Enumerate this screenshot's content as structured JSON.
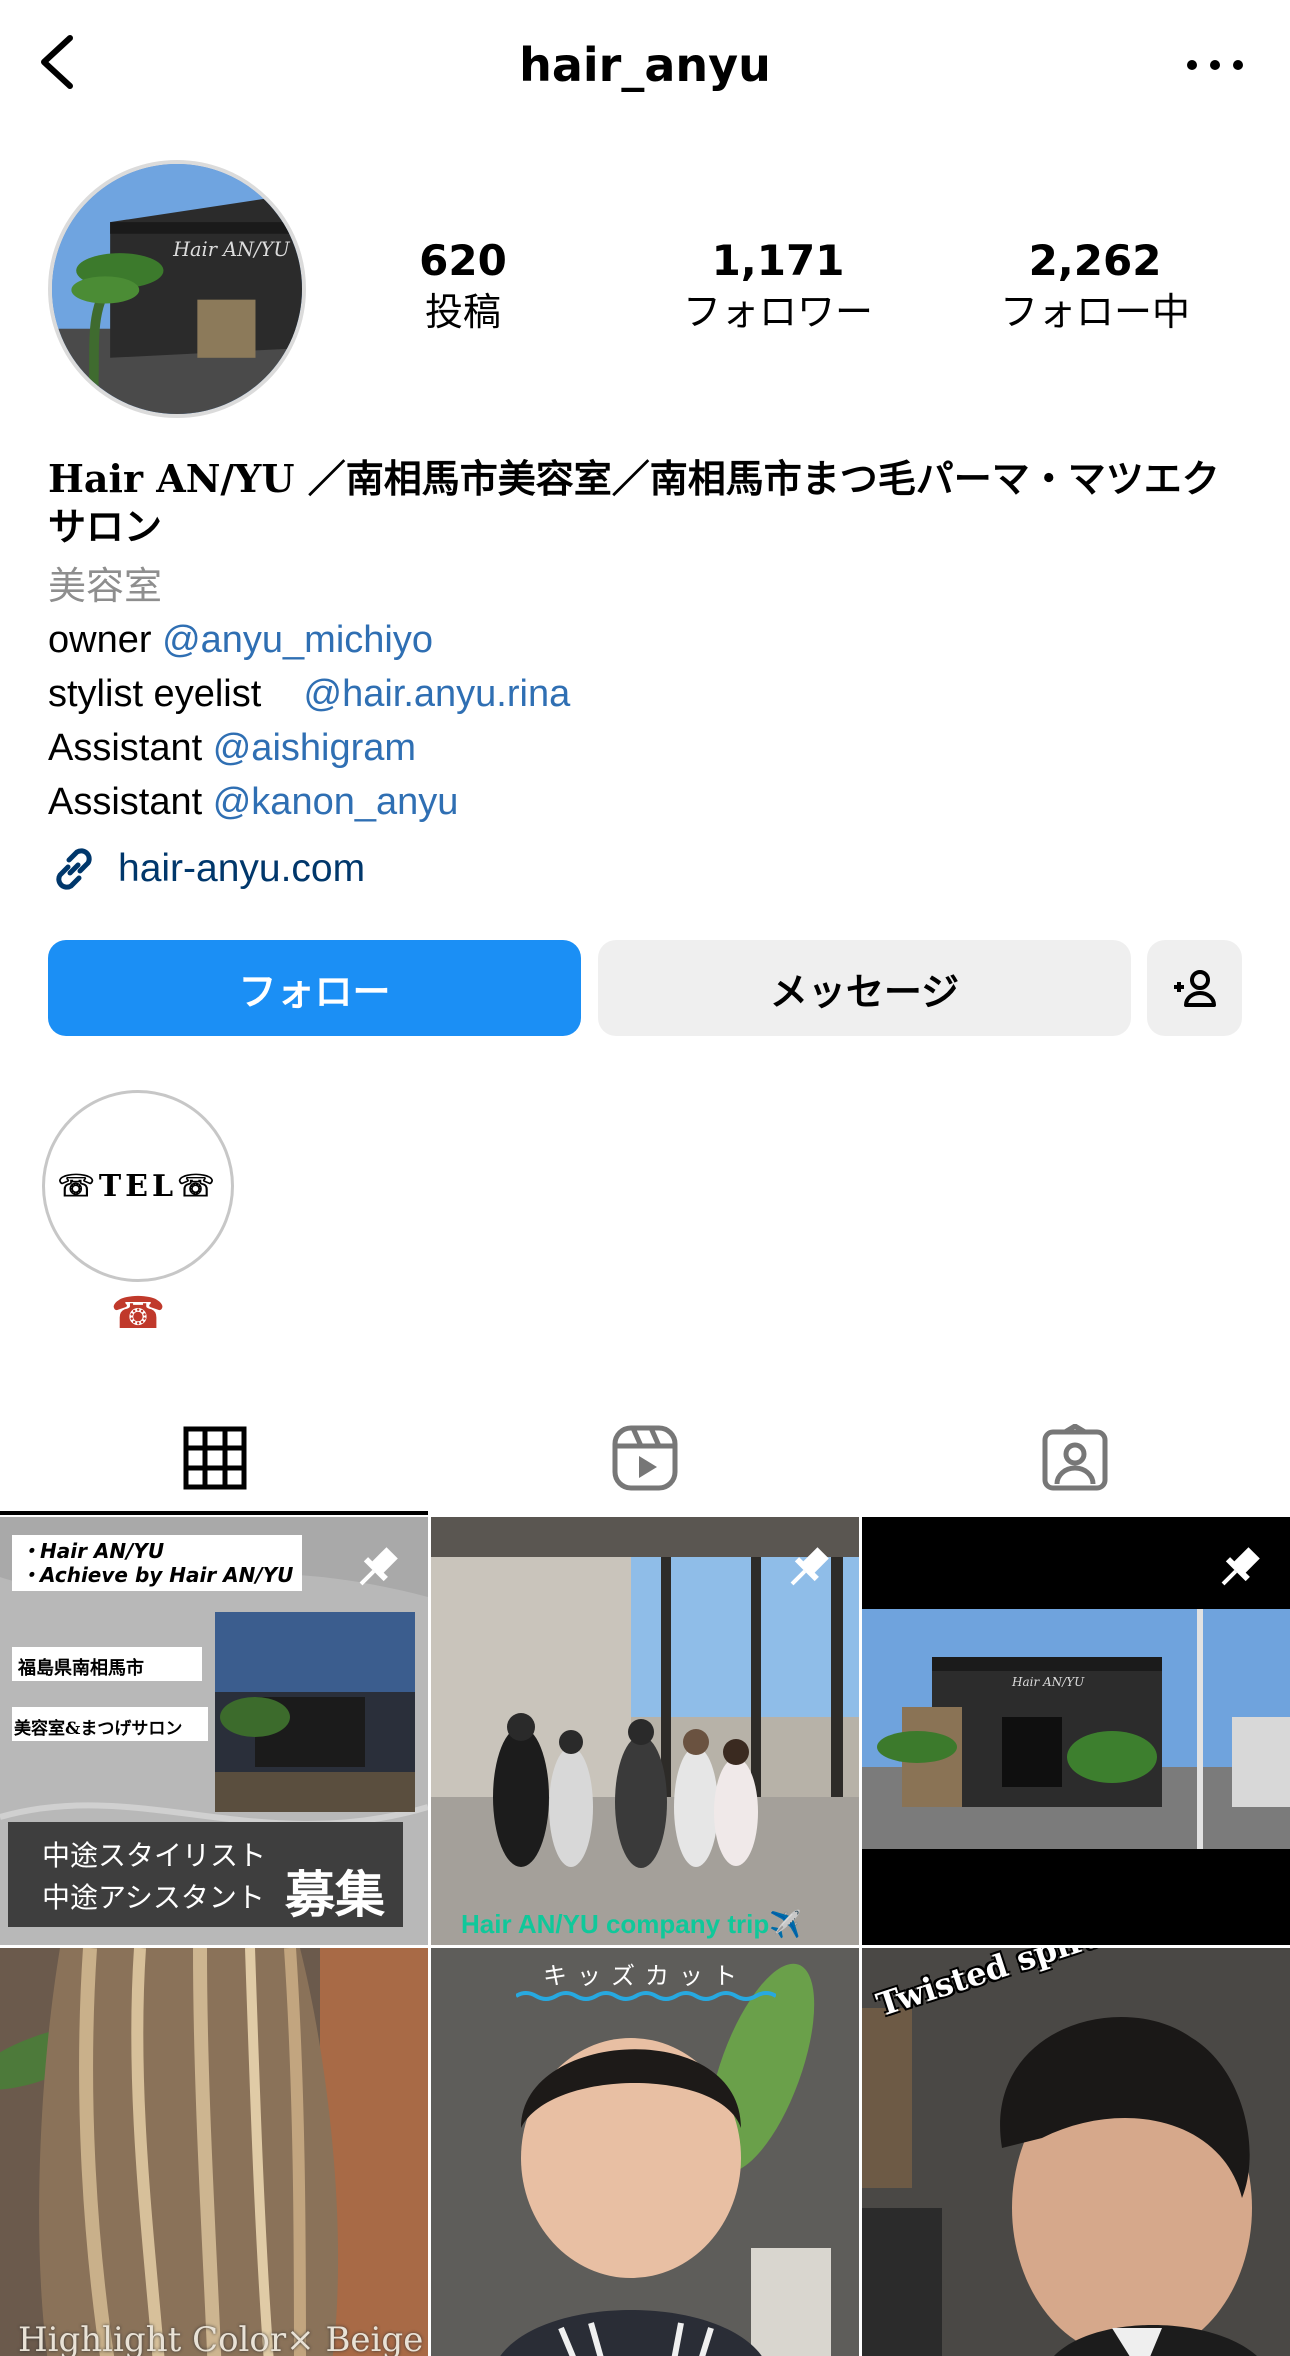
{
  "header": {
    "username": "hair_anyu"
  },
  "stats": [
    {
      "value": "620",
      "label": "投稿"
    },
    {
      "value": "1,171",
      "label": "フォロワー"
    },
    {
      "value": "2,262",
      "label": "フォロー中"
    }
  ],
  "bio": {
    "name_line1": "Hair AN/YU ／南相馬市美容室／南相馬市まつ毛パーマ・マツエク",
    "name_line2": "サロン",
    "category": "美容室",
    "lines": [
      {
        "prefix": "owner ",
        "mention": "@anyu_michiyo"
      },
      {
        "prefix": "stylist eyelist    ",
        "mention": "@hair.anyu.rina"
      },
      {
        "prefix": "Assistant ",
        "mention": "@aishigram"
      },
      {
        "prefix": "Assistant ",
        "mention": "@kanon_anyu"
      }
    ],
    "link": "hair-anyu.com"
  },
  "buttons": {
    "follow": "フォロー",
    "message": "メッセージ"
  },
  "highlight": {
    "cover_text": "☏TEL☏",
    "label": "☎"
  },
  "posts": [
    {
      "lines_top": [
        "・Hair AN/YU",
        "・Achieve by Hair AN/YU"
      ],
      "tag1": "福島県南相馬市",
      "tag2": "美容室&まつげサロン",
      "banner1": "中途スタイリスト",
      "banner2": "中途アシスタント",
      "banner_big": "募集"
    },
    {
      "caption": "Hair AN/YU company trip✈️"
    },
    {
      "sign": "Hair AN/YU"
    },
    {
      "caption": "Highlight Color× Beige"
    },
    {
      "caption": "キッズカット"
    },
    {
      "caption": "Twisted spiral"
    }
  ],
  "colors": {
    "primary": "#1b8ff5",
    "mention": "#2f6fb3",
    "link": "#00376b",
    "muted": "#8e8e8e"
  }
}
